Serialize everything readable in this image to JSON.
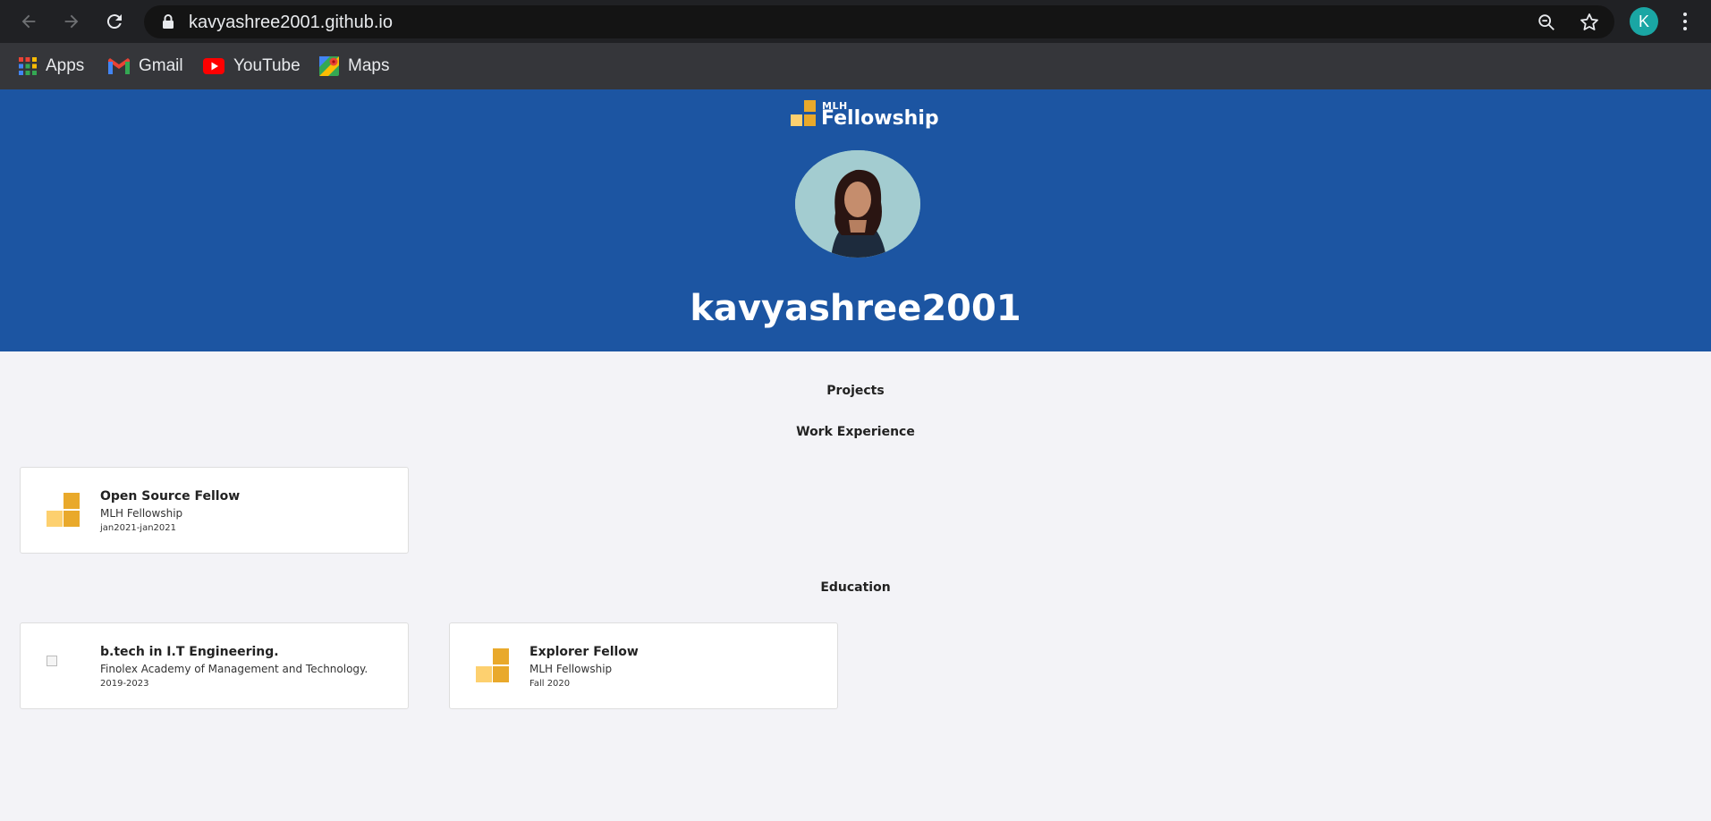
{
  "browser": {
    "url": "kavyashree2001.github.io",
    "profile_initial": "K",
    "bookmarks": [
      {
        "label": "Apps",
        "icon": "apps-grid-icon"
      },
      {
        "label": "Gmail",
        "icon": "gmail-icon"
      },
      {
        "label": "YouTube",
        "icon": "youtube-icon"
      },
      {
        "label": "Maps",
        "icon": "maps-icon"
      }
    ]
  },
  "header": {
    "logo_small": "MLH",
    "logo_big": "Fellowship",
    "username": "kavyashree2001",
    "background_color": "#1c55a2"
  },
  "sections": {
    "projects": "Projects",
    "work_experience": "Work Experience",
    "education": "Education"
  },
  "work": [
    {
      "title": "Open Source Fellow",
      "org": "MLH Fellowship",
      "date": "jan2021-jan2021"
    }
  ],
  "education": [
    {
      "title": "b.tech in I.T Engineering.",
      "org": "Finolex Academy of Management and Technology.",
      "date": "2019-2023"
    },
    {
      "title": "Explorer Fellow",
      "org": "MLH Fellowship",
      "date": "Fall 2020"
    }
  ],
  "colors": {
    "accent_gold": "#e9a92b",
    "accent_gold_light": "#fdd06f"
  }
}
